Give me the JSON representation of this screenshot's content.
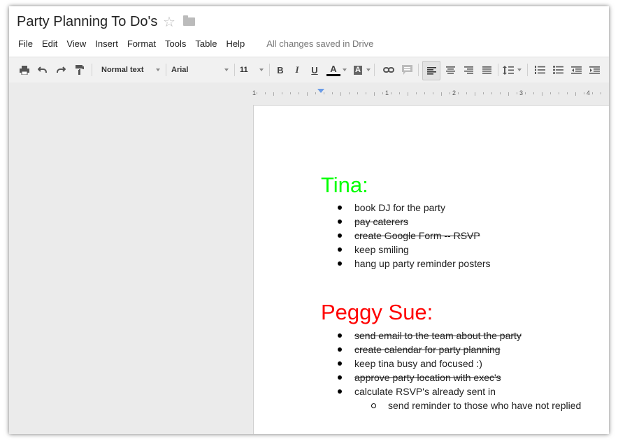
{
  "doc": {
    "title": "Party Planning To Do's",
    "save_status": "All changes saved in Drive"
  },
  "menu": [
    "File",
    "Edit",
    "View",
    "Insert",
    "Format",
    "Tools",
    "Table",
    "Help"
  ],
  "toolbar": {
    "style_label": "Normal text",
    "font_label": "Arial",
    "size_label": "11",
    "bold": "B",
    "italic": "I",
    "underline": "U",
    "text_color": "A",
    "highlight": "A"
  },
  "ruler": {
    "labels": [
      "1",
      "1",
      "2",
      "3",
      "4"
    ]
  },
  "colors": {
    "tina": "#00ff00",
    "peggy": "#ff0000"
  },
  "sections": [
    {
      "heading": "Tina:",
      "items": [
        {
          "text": "book DJ for the party",
          "done": false
        },
        {
          "text": "pay caterers",
          "done": true
        },
        {
          "text": "create Google Form -- RSVP",
          "done": true
        },
        {
          "text": "keep smiling",
          "done": false
        },
        {
          "text": "hang up party reminder posters",
          "done": false
        }
      ]
    },
    {
      "heading": "Peggy Sue:",
      "items": [
        {
          "text": "send email to the team about the party",
          "done": true
        },
        {
          "text": "create calendar for party planning",
          "done": true
        },
        {
          "text": "keep tina busy and focused :)",
          "done": false
        },
        {
          "text": "approve party location with exec's",
          "done": true
        },
        {
          "text": "calculate RSVP's already sent in",
          "done": false
        }
      ],
      "subitems": [
        {
          "text": "send reminder to those who have not replied",
          "done": false
        }
      ]
    }
  ]
}
